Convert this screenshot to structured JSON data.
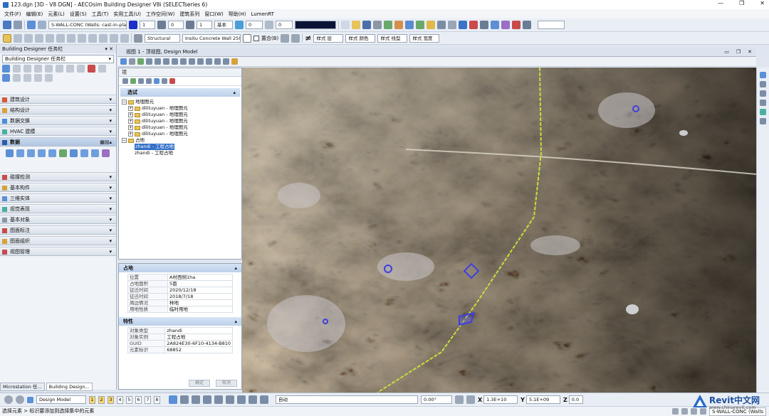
{
  "window": {
    "title": "123.dgn [3D - V8 DGN] - AECOsim Building Designer V8i (SELECTseries 6)",
    "controls": [
      "—",
      "❐",
      "✕"
    ]
  },
  "menu": [
    "文件(F)",
    "编辑(E)",
    "元素(L)",
    "设置(S)",
    "工具(T)",
    "实用工具(U)",
    "工作空间(W)",
    "建筑系列",
    "窗口(W)",
    "帮助(H)",
    "LumenRT"
  ],
  "toolbar1": {
    "wall_combo": "S-WALL-CONC (Walls: cast-in-place c",
    "level_value": "1",
    "weight_value": "0",
    "lineweight_value": "1",
    "style_label": "基本",
    "transparency_value": "0",
    "priority_value": "0"
  },
  "toolbar2": {
    "family": "Structural",
    "part": "Insitu Concrete Wall 250m",
    "checkbox_label": "置合(B)",
    "style_buttons": [
      "样式 层",
      "样式 颜色",
      "样式 线型",
      "样式 宽度"
    ]
  },
  "left_panel": {
    "title": "Building Designer 任务栏",
    "combo": "Building Designer 任务栏",
    "sections": [
      {
        "label": "建筑设计",
        "open": false
      },
      {
        "label": "结构设计",
        "open": false
      },
      {
        "label": "数据交换",
        "open": false
      },
      {
        "label": "HVAC 建模",
        "open": false
      },
      {
        "label": "数据",
        "open": true
      },
      {
        "label": "碰撞检测",
        "open": false
      },
      {
        "label": "基本构件",
        "open": false
      },
      {
        "label": "三维实体",
        "open": false
      },
      {
        "label": "视觉表现",
        "open": false
      },
      {
        "label": "基本对象",
        "open": false
      },
      {
        "label": "图面标注",
        "open": false
      },
      {
        "label": "图面组织",
        "open": false
      },
      {
        "label": "视图管理",
        "open": false
      }
    ],
    "tabs": [
      "Microstation 任...",
      "Building Design..."
    ]
  },
  "view": {
    "title": "视图 1 - 顶视图, Design Model"
  },
  "explorer": {
    "title": "项",
    "header": "选试",
    "tree": [
      {
        "label": "地理图元",
        "level": 0,
        "sign": "−"
      },
      {
        "label": "dilituyuan - 地理图元",
        "level": 1,
        "sign": "+"
      },
      {
        "label": "dilituyuan - 地理图元",
        "level": 1,
        "sign": "+"
      },
      {
        "label": "dilituyuan - 地理图元",
        "level": 1,
        "sign": "+"
      },
      {
        "label": "dilituyuan - 地理图元",
        "level": 1,
        "sign": "+"
      },
      {
        "label": "dilituyuan - 地理图元",
        "level": 1,
        "sign": "+"
      },
      {
        "label": "占地",
        "level": 0,
        "sign": "−"
      },
      {
        "label": "zhandi - 工程占地",
        "level": 1,
        "sign": "",
        "selected": true
      },
      {
        "label": "zhandi - 工程占地",
        "level": 1,
        "sign": ""
      }
    ]
  },
  "properties": {
    "section1": "占地",
    "rows1": [
      {
        "k": "位置",
        "v": "A村西侧1ha"
      },
      {
        "k": "占地面积",
        "v": "5亩"
      },
      {
        "k": "征迁时间",
        "v": "2020/12/18"
      },
      {
        "k": "征迁时间",
        "v": "2018/7/18"
      },
      {
        "k": "周边情况",
        "v": "林地"
      },
      {
        "k": "用地性质",
        "v": "临时用地"
      }
    ],
    "section2": "特性",
    "rows2": [
      {
        "k": "对象类型",
        "v": "zhandi"
      },
      {
        "k": "对象实例",
        "v": "工程占地"
      },
      {
        "k": "GUID",
        "v": "2A824E30-6F10-4134-B810"
      },
      {
        "k": "元素标识",
        "v": "68852"
      }
    ],
    "buttons": [
      "确定",
      "取消"
    ]
  },
  "bottom": {
    "view_combo": "Design Model",
    "view_numbers": [
      "1",
      "2",
      "3",
      "4",
      "5",
      "6",
      "7",
      "8"
    ],
    "active_numbers": [
      1,
      2,
      3
    ],
    "snap_combo": "自动",
    "angle_value": "0.00°",
    "x_label": "X",
    "x_value": "1.3E+10",
    "y_label": "Y",
    "y_value": "5.1E+09",
    "z_label": "Z",
    "z_value": "0.0"
  },
  "status": {
    "left": "选择元素 > 标识要添加到选择集中的元素",
    "right": "S-WALL-CONC (Walls"
  },
  "watermark": {
    "brand": "Revit中文网",
    "url": "www.chinarevit.com"
  }
}
